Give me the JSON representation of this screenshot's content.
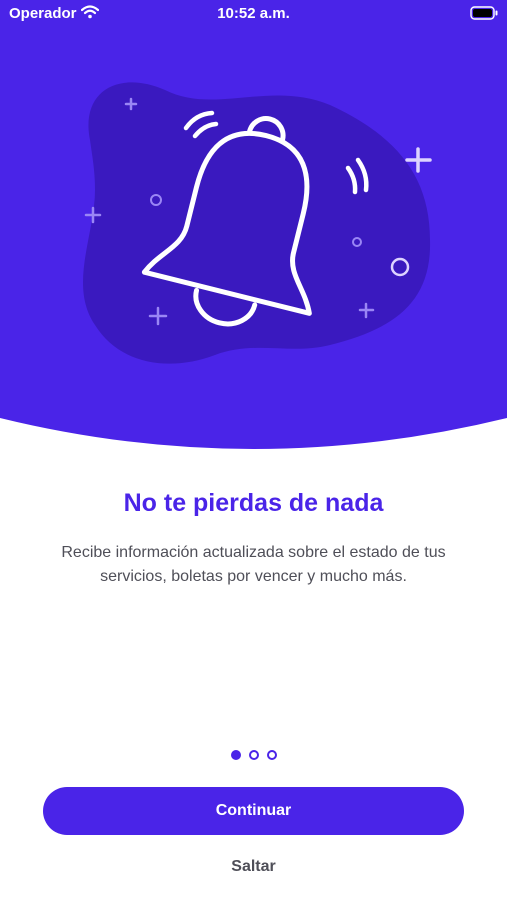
{
  "status_bar": {
    "carrier": "Operador",
    "time": "10:52 a.m."
  },
  "onboarding": {
    "title": "No te pierdas de nada",
    "description": "Recibe información actualizada sobre el estado de tus servicios, boletas por vencer y mucho más.",
    "page_indicator": {
      "total": 3,
      "current": 1
    },
    "continue_label": "Continuar",
    "skip_label": "Saltar"
  },
  "colors": {
    "brand": "#4a24e8",
    "hero_dark": "#3a19bf",
    "text_secondary": "#4f4f58"
  }
}
